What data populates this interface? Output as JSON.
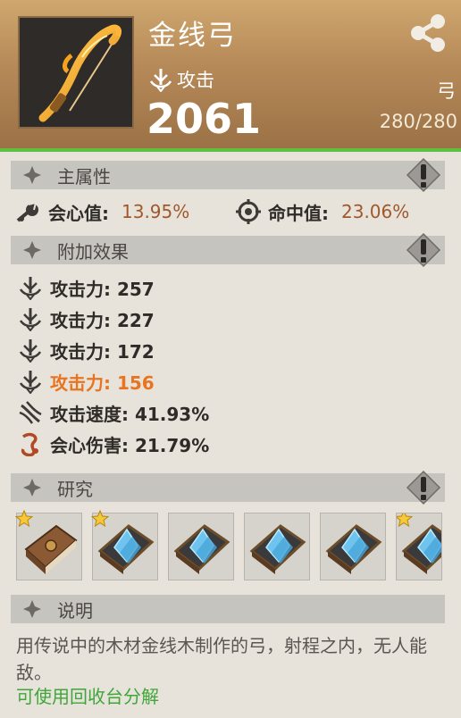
{
  "item": {
    "name": "金线弓",
    "type_label": "攻击",
    "power": "2061",
    "category": "弓",
    "durability": "280/280",
    "icon": "golden-bow-icon"
  },
  "sections": {
    "main_attr": "主属性",
    "extra_effects": "附加效果",
    "research": "研究",
    "description": "说明"
  },
  "main_stats": [
    {
      "icon": "crit-icon",
      "label": "会心值:",
      "value": "13.95%"
    },
    {
      "icon": "accuracy-icon",
      "label": "命中值:",
      "value": "23.06%"
    }
  ],
  "extra_stats": [
    {
      "icon": "attack-icon",
      "text": "攻击力: 257",
      "highlight": false
    },
    {
      "icon": "attack-icon",
      "text": "攻击力: 227",
      "highlight": false
    },
    {
      "icon": "attack-icon",
      "text": "攻击力: 172",
      "highlight": false
    },
    {
      "icon": "attack-icon",
      "text": "攻击力: 156",
      "highlight": true
    },
    {
      "icon": "attack-speed-icon",
      "text": "攻击速度: 41.93%",
      "highlight": false
    },
    {
      "icon": "crit-damage-icon",
      "text": "会心伤害: 21.79%",
      "highlight": false
    }
  ],
  "research_slots": [
    {
      "icon": "leather-book-icon",
      "starred": true
    },
    {
      "icon": "crystal-book-icon",
      "starred": true
    },
    {
      "icon": "crystal-book-icon",
      "starred": false
    },
    {
      "icon": "crystal-book-icon",
      "starred": false
    },
    {
      "icon": "crystal-book-icon",
      "starred": false
    },
    {
      "icon": "crystal-book-icon",
      "starred": true
    }
  ],
  "description": {
    "text": "用传说中的木材金线木制作的弓，射程之内，无人能敌。",
    "recycle": "可使用回收台分解"
  },
  "colors": {
    "accent_green": "#5fbf3e",
    "highlight_orange": "#e9741f",
    "value_brown": "#a0582b"
  }
}
